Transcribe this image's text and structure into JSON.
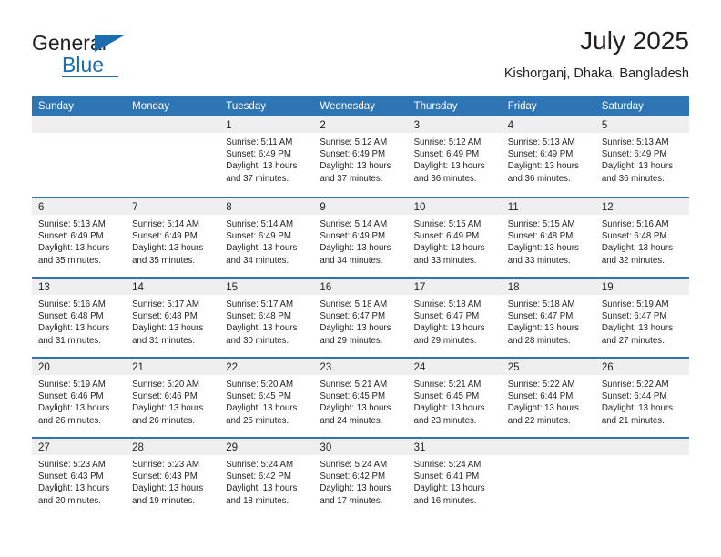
{
  "brand": {
    "name_top": "General",
    "name_bottom": "Blue",
    "accent_color": "#1b6cb0"
  },
  "header": {
    "title": "July 2025",
    "subtitle": "Kishorganj, Dhaka, Bangladesh"
  },
  "calendar": {
    "header_color": "#2e75b6",
    "day_band_color": "#efefef",
    "day_names": [
      "Sunday",
      "Monday",
      "Tuesday",
      "Wednesday",
      "Thursday",
      "Friday",
      "Saturday"
    ],
    "weeks": [
      [
        {
          "day": "",
          "sunrise": "",
          "sunset": "",
          "daylight": ""
        },
        {
          "day": "",
          "sunrise": "",
          "sunset": "",
          "daylight": ""
        },
        {
          "day": "1",
          "sunrise": "Sunrise: 5:11 AM",
          "sunset": "Sunset: 6:49 PM",
          "daylight": "Daylight: 13 hours and 37 minutes."
        },
        {
          "day": "2",
          "sunrise": "Sunrise: 5:12 AM",
          "sunset": "Sunset: 6:49 PM",
          "daylight": "Daylight: 13 hours and 37 minutes."
        },
        {
          "day": "3",
          "sunrise": "Sunrise: 5:12 AM",
          "sunset": "Sunset: 6:49 PM",
          "daylight": "Daylight: 13 hours and 36 minutes."
        },
        {
          "day": "4",
          "sunrise": "Sunrise: 5:13 AM",
          "sunset": "Sunset: 6:49 PM",
          "daylight": "Daylight: 13 hours and 36 minutes."
        },
        {
          "day": "5",
          "sunrise": "Sunrise: 5:13 AM",
          "sunset": "Sunset: 6:49 PM",
          "daylight": "Daylight: 13 hours and 36 minutes."
        }
      ],
      [
        {
          "day": "6",
          "sunrise": "Sunrise: 5:13 AM",
          "sunset": "Sunset: 6:49 PM",
          "daylight": "Daylight: 13 hours and 35 minutes."
        },
        {
          "day": "7",
          "sunrise": "Sunrise: 5:14 AM",
          "sunset": "Sunset: 6:49 PM",
          "daylight": "Daylight: 13 hours and 35 minutes."
        },
        {
          "day": "8",
          "sunrise": "Sunrise: 5:14 AM",
          "sunset": "Sunset: 6:49 PM",
          "daylight": "Daylight: 13 hours and 34 minutes."
        },
        {
          "day": "9",
          "sunrise": "Sunrise: 5:14 AM",
          "sunset": "Sunset: 6:49 PM",
          "daylight": "Daylight: 13 hours and 34 minutes."
        },
        {
          "day": "10",
          "sunrise": "Sunrise: 5:15 AM",
          "sunset": "Sunset: 6:49 PM",
          "daylight": "Daylight: 13 hours and 33 minutes."
        },
        {
          "day": "11",
          "sunrise": "Sunrise: 5:15 AM",
          "sunset": "Sunset: 6:48 PM",
          "daylight": "Daylight: 13 hours and 33 minutes."
        },
        {
          "day": "12",
          "sunrise": "Sunrise: 5:16 AM",
          "sunset": "Sunset: 6:48 PM",
          "daylight": "Daylight: 13 hours and 32 minutes."
        }
      ],
      [
        {
          "day": "13",
          "sunrise": "Sunrise: 5:16 AM",
          "sunset": "Sunset: 6:48 PM",
          "daylight": "Daylight: 13 hours and 31 minutes."
        },
        {
          "day": "14",
          "sunrise": "Sunrise: 5:17 AM",
          "sunset": "Sunset: 6:48 PM",
          "daylight": "Daylight: 13 hours and 31 minutes."
        },
        {
          "day": "15",
          "sunrise": "Sunrise: 5:17 AM",
          "sunset": "Sunset: 6:48 PM",
          "daylight": "Daylight: 13 hours and 30 minutes."
        },
        {
          "day": "16",
          "sunrise": "Sunrise: 5:18 AM",
          "sunset": "Sunset: 6:47 PM",
          "daylight": "Daylight: 13 hours and 29 minutes."
        },
        {
          "day": "17",
          "sunrise": "Sunrise: 5:18 AM",
          "sunset": "Sunset: 6:47 PM",
          "daylight": "Daylight: 13 hours and 29 minutes."
        },
        {
          "day": "18",
          "sunrise": "Sunrise: 5:18 AM",
          "sunset": "Sunset: 6:47 PM",
          "daylight": "Daylight: 13 hours and 28 minutes."
        },
        {
          "day": "19",
          "sunrise": "Sunrise: 5:19 AM",
          "sunset": "Sunset: 6:47 PM",
          "daylight": "Daylight: 13 hours and 27 minutes."
        }
      ],
      [
        {
          "day": "20",
          "sunrise": "Sunrise: 5:19 AM",
          "sunset": "Sunset: 6:46 PM",
          "daylight": "Daylight: 13 hours and 26 minutes."
        },
        {
          "day": "21",
          "sunrise": "Sunrise: 5:20 AM",
          "sunset": "Sunset: 6:46 PM",
          "daylight": "Daylight: 13 hours and 26 minutes."
        },
        {
          "day": "22",
          "sunrise": "Sunrise: 5:20 AM",
          "sunset": "Sunset: 6:45 PM",
          "daylight": "Daylight: 13 hours and 25 minutes."
        },
        {
          "day": "23",
          "sunrise": "Sunrise: 5:21 AM",
          "sunset": "Sunset: 6:45 PM",
          "daylight": "Daylight: 13 hours and 24 minutes."
        },
        {
          "day": "24",
          "sunrise": "Sunrise: 5:21 AM",
          "sunset": "Sunset: 6:45 PM",
          "daylight": "Daylight: 13 hours and 23 minutes."
        },
        {
          "day": "25",
          "sunrise": "Sunrise: 5:22 AM",
          "sunset": "Sunset: 6:44 PM",
          "daylight": "Daylight: 13 hours and 22 minutes."
        },
        {
          "day": "26",
          "sunrise": "Sunrise: 5:22 AM",
          "sunset": "Sunset: 6:44 PM",
          "daylight": "Daylight: 13 hours and 21 minutes."
        }
      ],
      [
        {
          "day": "27",
          "sunrise": "Sunrise: 5:23 AM",
          "sunset": "Sunset: 6:43 PM",
          "daylight": "Daylight: 13 hours and 20 minutes."
        },
        {
          "day": "28",
          "sunrise": "Sunrise: 5:23 AM",
          "sunset": "Sunset: 6:43 PM",
          "daylight": "Daylight: 13 hours and 19 minutes."
        },
        {
          "day": "29",
          "sunrise": "Sunrise: 5:24 AM",
          "sunset": "Sunset: 6:42 PM",
          "daylight": "Daylight: 13 hours and 18 minutes."
        },
        {
          "day": "30",
          "sunrise": "Sunrise: 5:24 AM",
          "sunset": "Sunset: 6:42 PM",
          "daylight": "Daylight: 13 hours and 17 minutes."
        },
        {
          "day": "31",
          "sunrise": "Sunrise: 5:24 AM",
          "sunset": "Sunset: 6:41 PM",
          "daylight": "Daylight: 13 hours and 16 minutes."
        },
        {
          "day": "",
          "sunrise": "",
          "sunset": "",
          "daylight": ""
        },
        {
          "day": "",
          "sunrise": "",
          "sunset": "",
          "daylight": ""
        }
      ]
    ]
  }
}
